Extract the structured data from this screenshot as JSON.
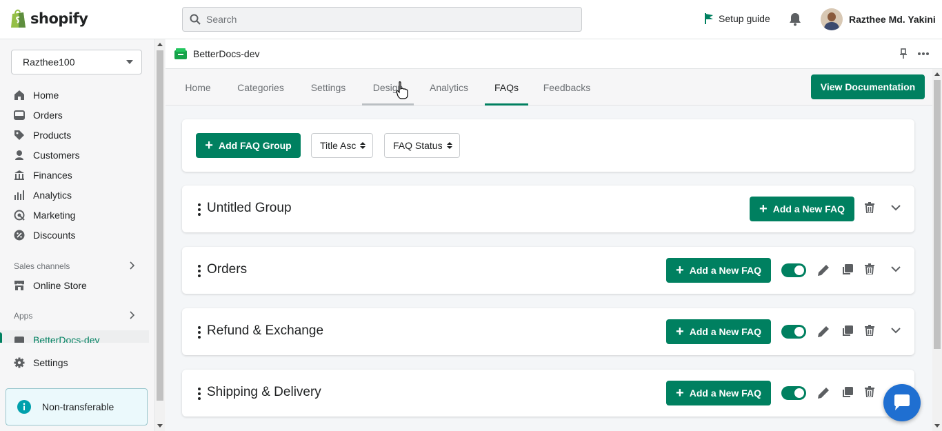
{
  "brand": {
    "name": "shopify",
    "accent": "#008060"
  },
  "search": {
    "placeholder": "Search"
  },
  "topbar": {
    "setup_guide": "Setup guide",
    "user_name": "Razthee Md. Yakini"
  },
  "sidebar": {
    "store": "Razthee100",
    "items": [
      {
        "label": "Home",
        "icon": "home-icon"
      },
      {
        "label": "Orders",
        "icon": "orders-icon"
      },
      {
        "label": "Products",
        "icon": "tag-icon"
      },
      {
        "label": "Customers",
        "icon": "person-icon"
      },
      {
        "label": "Finances",
        "icon": "bank-icon"
      },
      {
        "label": "Analytics",
        "icon": "bar-chart-icon"
      },
      {
        "label": "Marketing",
        "icon": "target-icon"
      },
      {
        "label": "Discounts",
        "icon": "discount-icon"
      }
    ],
    "sales_channels_label": "Sales channels",
    "online_store": "Online Store",
    "apps_label": "Apps",
    "app_item": "BetterDocs-dev",
    "settings": "Settings",
    "notice": "Non-transferable"
  },
  "app": {
    "title": "BetterDocs-dev"
  },
  "tabs": [
    {
      "label": "Home"
    },
    {
      "label": "Categories"
    },
    {
      "label": "Settings"
    },
    {
      "label": "Design"
    },
    {
      "label": "Analytics"
    },
    {
      "label": "FAQs"
    },
    {
      "label": "Feedbacks"
    }
  ],
  "active_tab": "FAQs",
  "view_documentation": "View Documentation",
  "toolbar": {
    "add_group": "Add FAQ Group",
    "sort": "Title Asc",
    "status": "FAQ Status"
  },
  "groups": [
    {
      "title": "Untitled Group",
      "add_label": "Add a New FAQ",
      "enabled": null
    },
    {
      "title": "Orders",
      "add_label": "Add a New FAQ",
      "enabled": true
    },
    {
      "title": "Refund & Exchange",
      "add_label": "Add a New FAQ",
      "enabled": true
    },
    {
      "title": "Shipping & Delivery",
      "add_label": "Add a New FAQ",
      "enabled": true
    }
  ]
}
